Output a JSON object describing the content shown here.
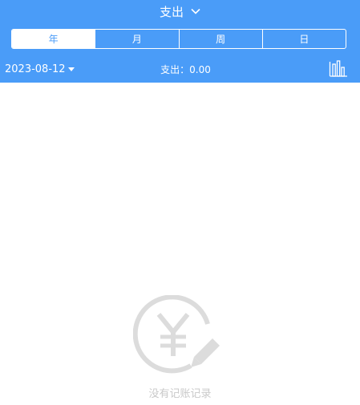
{
  "header": {
    "title": "支出",
    "tabs": [
      "年",
      "月",
      "周",
      "日"
    ],
    "active_tab": 0,
    "date": "2023-08-12",
    "summary_label": "支出：0.00",
    "chart_icon": "bar-chart-icon"
  },
  "empty_state": {
    "icon": "yen-pencil-icon",
    "message": "没有记账记录"
  },
  "colors": {
    "accent": "#4a9cf8",
    "empty_icon": "#dcdcdc",
    "empty_text": "#c9c9c9"
  }
}
